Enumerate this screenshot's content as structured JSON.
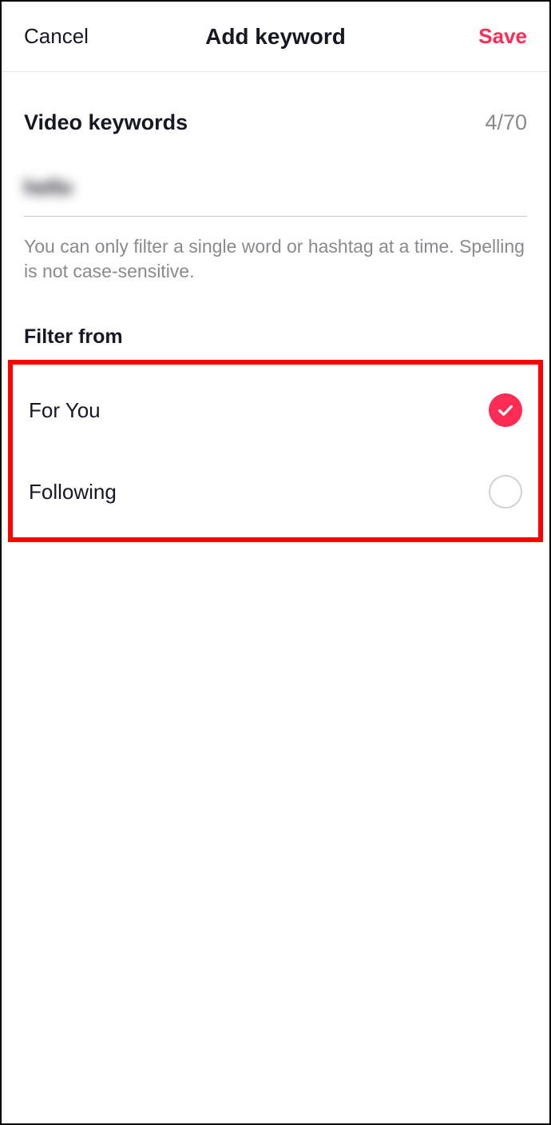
{
  "header": {
    "cancel_label": "Cancel",
    "title": "Add keyword",
    "save_label": "Save"
  },
  "video_keywords": {
    "label": "Video keywords",
    "count": "4/70",
    "input_value": "hello"
  },
  "help_text": "You can only filter a single word or hashtag at a time. Spelling is not case-sensitive.",
  "filter_from": {
    "label": "Filter from",
    "options": [
      {
        "label": "For You",
        "checked": true
      },
      {
        "label": "Following",
        "checked": false
      }
    ]
  },
  "colors": {
    "accent": "#fe2c55",
    "highlight_border": "#ff0000"
  }
}
